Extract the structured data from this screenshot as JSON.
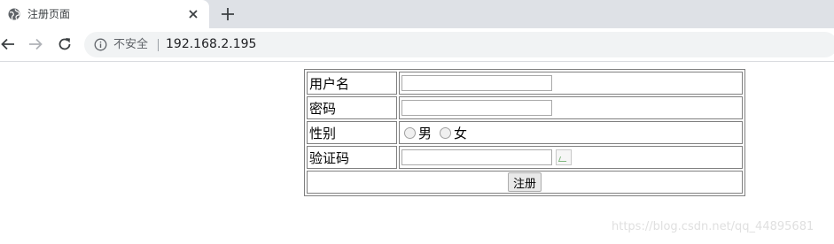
{
  "browser": {
    "tab_title": "注册页面",
    "security_label": "不安全",
    "url": "192.168.2.195",
    "icons": {
      "favicon": "globe-icon",
      "close": "close-icon",
      "new_tab": "plus-icon",
      "back": "back-arrow-icon",
      "forward": "forward-arrow-icon",
      "reload": "reload-icon",
      "info": "info-icon"
    }
  },
  "form": {
    "username_label": "用户名",
    "password_label": "密码",
    "gender_label": "性别",
    "gender_male": "男",
    "gender_female": "女",
    "captcha_label": "验证码",
    "username_value": "",
    "password_value": "",
    "captcha_value": "",
    "submit_label": "注册"
  },
  "watermark": "https://blog.csdn.net/qq_44895681"
}
